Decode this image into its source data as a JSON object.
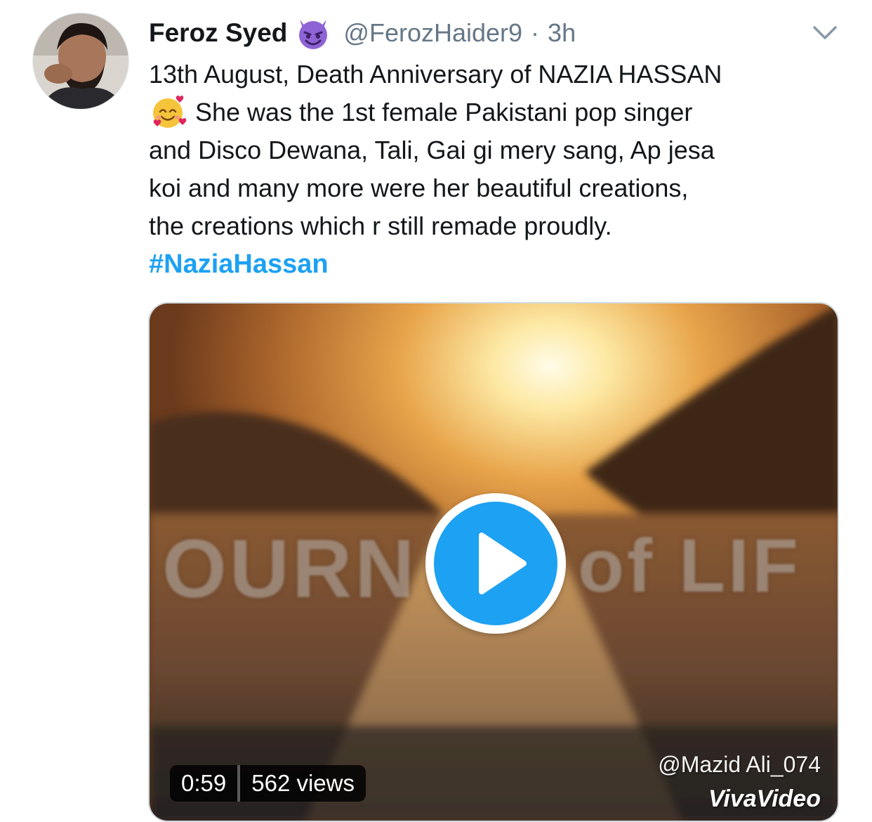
{
  "tweet": {
    "author": {
      "display_name": "Feroz Syed",
      "name_emoji": "smiling-imp-icon",
      "handle": "@FerozHaider9",
      "separator": "·",
      "timestamp": "3h"
    },
    "text_lines": [
      "13th August, Death Anniversary of NAZIA HASSAN",
      "She was the 1st female Pakistani pop singer",
      "and  Disco Dewana, Tali, Gai gi mery sang, Ap jesa",
      "koi and many more were her beautiful creations,",
      "the creations which r still remade proudly."
    ],
    "inline_emoji": "smiling-face-with-hearts-icon",
    "hashtag": "#NaziaHassan",
    "video": {
      "duration": "0:59",
      "views": "562 views",
      "watermark_handle": "@Mazid Ali_074",
      "watermark_app": "VivaVideo",
      "overlay_left": "OURN",
      "overlay_right": "of LIF"
    }
  },
  "colors": {
    "link": "#1da1f2",
    "secondary_text": "#657786",
    "primary_text": "#14171a",
    "emoji_purple": "#8e63d4"
  }
}
